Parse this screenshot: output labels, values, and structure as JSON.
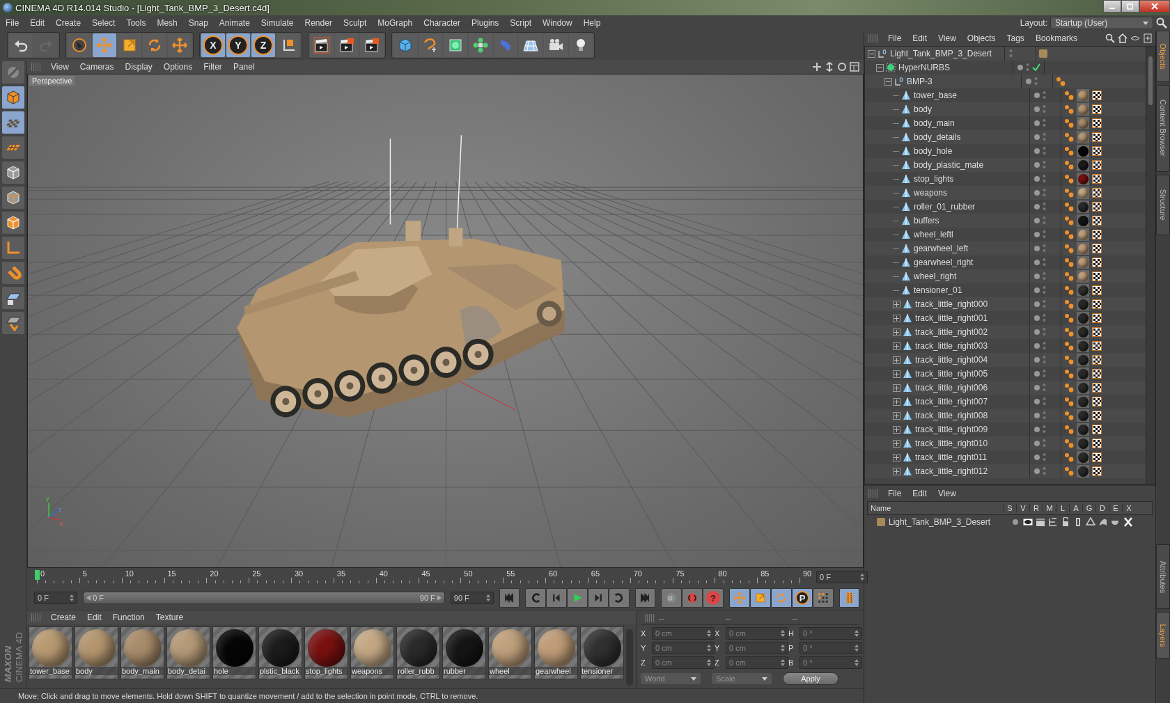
{
  "window": {
    "title": "CINEMA 4D R14.014 Studio - [Light_Tank_BMP_3_Desert.c4d]"
  },
  "menu": [
    "File",
    "Edit",
    "Create",
    "Select",
    "Tools",
    "Mesh",
    "Snap",
    "Animate",
    "Simulate",
    "Render",
    "Sculpt",
    "MoGraph",
    "Character",
    "Plugins",
    "Script",
    "Window",
    "Help"
  ],
  "layout": {
    "label": "Layout:",
    "value": "Startup (User)"
  },
  "toolbar": [
    [
      {
        "kind": "undo",
        "selected": false
      },
      {
        "kind": "redo",
        "selected": false,
        "disabled": true
      }
    ],
    [
      {
        "kind": "select",
        "selected": false
      },
      {
        "kind": "move",
        "selected": true
      },
      {
        "kind": "scale",
        "selected": false
      },
      {
        "kind": "rotate",
        "selected": false
      },
      {
        "kind": "cross",
        "selected": false
      }
    ],
    [
      {
        "kind": "axis",
        "label": "X",
        "selected": true
      },
      {
        "kind": "axis",
        "label": "Y",
        "selected": true
      },
      {
        "kind": "axis",
        "label": "Z",
        "selected": true
      },
      {
        "kind": "coords",
        "selected": false
      }
    ],
    [
      {
        "kind": "render",
        "selected": false
      },
      {
        "kind": "render-pv",
        "selected": false
      },
      {
        "kind": "render-set",
        "selected": false
      }
    ],
    [
      {
        "kind": "cube",
        "selected": false
      },
      {
        "kind": "pen",
        "selected": false
      },
      {
        "kind": "nurbs",
        "selected": false
      },
      {
        "kind": "cloner",
        "selected": false
      },
      {
        "kind": "deformer",
        "selected": false
      },
      {
        "kind": "floor",
        "selected": false
      },
      {
        "kind": "camera",
        "selected": false
      },
      {
        "kind": "light",
        "selected": false
      }
    ]
  ],
  "left_tools": [
    {
      "kind": "editable",
      "selected": false
    },
    {
      "kind": "model",
      "selected": true
    },
    {
      "kind": "texture",
      "selected": true
    },
    {
      "kind": "workplane",
      "selected": false
    },
    {
      "kind": "points",
      "selected": false
    },
    {
      "kind": "edges",
      "selected": false
    },
    {
      "kind": "polygons",
      "selected": false
    },
    {
      "kind": "axis-mode",
      "selected": false
    },
    {
      "kind": "magnet",
      "selected": false
    },
    {
      "kind": "lock-plane",
      "selected": false
    },
    {
      "kind": "snap",
      "selected": false
    }
  ],
  "logo": {
    "brand": "MAXON",
    "product": "CINEMA 4D"
  },
  "viewport": {
    "menu": [
      "View",
      "Cameras",
      "Display",
      "Options",
      "Filter",
      "Panel"
    ],
    "label": "Perspective",
    "axis_labels": [
      "y",
      "z",
      "x"
    ]
  },
  "timeline": {
    "ticks": [
      "0",
      "5",
      "10",
      "15",
      "20",
      "25",
      "30",
      "35",
      "40",
      "45",
      "50",
      "55",
      "60",
      "65",
      "70",
      "75",
      "80",
      "85",
      "90"
    ],
    "current": "0 F",
    "start": "0 F",
    "range": {
      "start": "0 F",
      "end": "90 F",
      "level": 1
    },
    "end": "90 F"
  },
  "playback": [
    {
      "kind": "first"
    },
    {
      "kind": "prev-key"
    },
    {
      "kind": "prev"
    },
    {
      "kind": "play"
    },
    {
      "kind": "next"
    },
    {
      "kind": "next-key"
    },
    {
      "kind": "last"
    }
  ],
  "record": [
    {
      "kind": "key-lock",
      "selected": false
    },
    {
      "kind": "autokey",
      "selected": false
    },
    {
      "kind": "help",
      "label": "?",
      "selected": false
    }
  ],
  "keymode": [
    {
      "kind": "move",
      "selected": true
    },
    {
      "kind": "scale",
      "selected": true
    },
    {
      "kind": "rotate",
      "selected": true
    },
    {
      "kind": "param",
      "label": "P",
      "selected": true
    },
    {
      "kind": "pla",
      "selected": false
    }
  ],
  "timeline_button": {
    "selected": true
  },
  "materials": {
    "menu": [
      "Create",
      "Edit",
      "Function",
      "Texture"
    ],
    "items": [
      {
        "name": "tower_base",
        "color": "#b89a72"
      },
      {
        "name": "body",
        "color": "#b49670"
      },
      {
        "name": "body_main",
        "color": "#a88c6a"
      },
      {
        "name": "body_detai",
        "color": "#b59a78"
      },
      {
        "name": "hole",
        "color": "#050505"
      },
      {
        "name": "plstic_black",
        "color": "#1c1c1c"
      },
      {
        "name": "stop_lights",
        "color": "#7a1010"
      },
      {
        "name": "weapons",
        "color": "#c4a884"
      },
      {
        "name": "roller_rubb",
        "color": "#2a2a2a"
      },
      {
        "name": "rubber",
        "color": "#151515"
      },
      {
        "name": "wheel",
        "color": "#c0a07c"
      },
      {
        "name": "gearwheel",
        "color": "#c09c78"
      },
      {
        "name": "tensioner",
        "color": "#303030"
      }
    ]
  },
  "coordinates": {
    "headers": [
      "--",
      "--",
      "--"
    ],
    "rows": [
      {
        "a": "X",
        "av": "0 cm",
        "b": "X",
        "bv": "0 cm",
        "c": "H",
        "cv": "0 °"
      },
      {
        "a": "Y",
        "av": "0 cm",
        "b": "Y",
        "bv": "0 cm",
        "c": "P",
        "cv": "0 °"
      },
      {
        "a": "Z",
        "av": "0 cm",
        "b": "Z",
        "bv": "0 cm",
        "c": "B",
        "cv": "0 °"
      }
    ],
    "space": "World",
    "mode": "Scale",
    "apply": "Apply"
  },
  "status_bar": "Move: Click and drag to move elements. Hold down SHIFT to quantize movement / add to the selection in point mode, CTRL to remove.",
  "objects": {
    "menu": [
      "File",
      "Edit",
      "View",
      "Objects",
      "Tags",
      "Bookmarks"
    ],
    "tree": [
      {
        "name": "Light_Tank_BMP_3_Desert",
        "kind": "null",
        "expanded": true,
        "color": "#a88a5a",
        "children": [
          {
            "name": "HyperNURBS",
            "kind": "nurbs",
            "expanded": true,
            "enabled": true,
            "children": [
              {
                "name": "BMP-3",
                "kind": "null",
                "expanded": true,
                "children": [
                  {
                    "name": "tower_base",
                    "kind": "poly",
                    "color": "#b89a72"
                  },
                  {
                    "name": "body",
                    "kind": "poly",
                    "color": "#b49670"
                  },
                  {
                    "name": "body_main",
                    "kind": "poly",
                    "color": "#a88c6a"
                  },
                  {
                    "name": "body_details",
                    "kind": "poly",
                    "color": "#b59a78"
                  },
                  {
                    "name": "body_hole",
                    "kind": "poly",
                    "color": "#050505"
                  },
                  {
                    "name": "body_plastic_mate",
                    "kind": "poly",
                    "color": "#1c1c1c"
                  },
                  {
                    "name": "stop_lights",
                    "kind": "poly",
                    "color": "#7a1010"
                  },
                  {
                    "name": "weapons",
                    "kind": "poly",
                    "color": "#c4a884"
                  },
                  {
                    "name": "roller_01_rubber",
                    "kind": "poly",
                    "color": "#2a2a2a"
                  },
                  {
                    "name": "buffers",
                    "kind": "poly",
                    "color": "#151515"
                  },
                  {
                    "name": "wheel_leftl",
                    "kind": "poly",
                    "color": "#c0a07c"
                  },
                  {
                    "name": "gearwheel_left",
                    "kind": "poly",
                    "color": "#c09c78"
                  },
                  {
                    "name": "gearwheel_right",
                    "kind": "poly",
                    "color": "#c09c78"
                  },
                  {
                    "name": "wheel_right",
                    "kind": "poly",
                    "color": "#c0a07c"
                  },
                  {
                    "name": "tensioner_01",
                    "kind": "poly",
                    "color": "#303030"
                  },
                  {
                    "name": "track_little_right000",
                    "kind": "poly",
                    "expanded": false,
                    "color": "#2a2a2a"
                  },
                  {
                    "name": "track_little_right001",
                    "kind": "poly",
                    "expanded": false,
                    "color": "#2a2a2a"
                  },
                  {
                    "name": "track_little_right002",
                    "kind": "poly",
                    "expanded": false,
                    "color": "#2a2a2a"
                  },
                  {
                    "name": "track_little_right003",
                    "kind": "poly",
                    "expanded": false,
                    "color": "#2a2a2a"
                  },
                  {
                    "name": "track_little_right004",
                    "kind": "poly",
                    "expanded": false,
                    "color": "#2a2a2a"
                  },
                  {
                    "name": "track_little_right005",
                    "kind": "poly",
                    "expanded": false,
                    "color": "#2a2a2a"
                  },
                  {
                    "name": "track_little_right006",
                    "kind": "poly",
                    "expanded": false,
                    "color": "#2a2a2a"
                  },
                  {
                    "name": "track_little_right007",
                    "kind": "poly",
                    "expanded": false,
                    "color": "#2a2a2a"
                  },
                  {
                    "name": "track_little_right008",
                    "kind": "poly",
                    "expanded": false,
                    "color": "#2a2a2a"
                  },
                  {
                    "name": "track_little_right009",
                    "kind": "poly",
                    "expanded": false,
                    "color": "#2a2a2a"
                  },
                  {
                    "name": "track_little_right010",
                    "kind": "poly",
                    "expanded": false,
                    "color": "#2a2a2a"
                  },
                  {
                    "name": "track_little_right011",
                    "kind": "poly",
                    "expanded": false,
                    "color": "#2a2a2a"
                  },
                  {
                    "name": "track_little_right012",
                    "kind": "poly",
                    "expanded": false,
                    "color": "#2a2a2a"
                  }
                ]
              }
            ]
          }
        ]
      }
    ]
  },
  "side_tabs_top": [
    {
      "label": "Objects",
      "selected": true
    },
    {
      "label": "Content Browser",
      "selected": false
    },
    {
      "label": "Structure",
      "selected": false
    }
  ],
  "side_tabs_bottom": [
    {
      "label": "Attributes",
      "selected": false
    },
    {
      "label": "Layers",
      "selected": true
    }
  ],
  "layers": {
    "menu": [
      "File",
      "Edit",
      "View"
    ],
    "columns": [
      "Name",
      "S",
      "V",
      "R",
      "M",
      "L",
      "A",
      "G",
      "D",
      "E",
      "X"
    ],
    "rows": [
      {
        "name": "Light_Tank_BMP_3_Desert",
        "color": "#a88a5a"
      }
    ]
  }
}
